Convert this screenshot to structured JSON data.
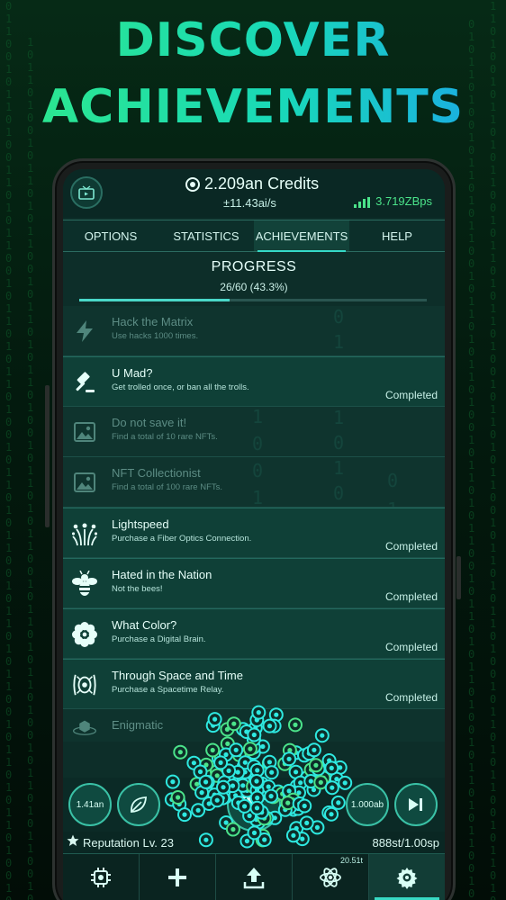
{
  "promo": {
    "line1": "DISCOVER",
    "line2": "ACHIEVEMENTS"
  },
  "header": {
    "credits": "2.209an Credits",
    "rate": "±11.43ai/s",
    "bandwidth": "3.719ZBps"
  },
  "tabs": [
    {
      "label": "OPTIONS"
    },
    {
      "label": "STATISTICS"
    },
    {
      "label": "ACHIEVEMENTS",
      "active": true
    },
    {
      "label": "HELP"
    }
  ],
  "progress": {
    "title": "PROGRESS",
    "count": "26/60 (43.3%)",
    "fraction": 0.433
  },
  "achievements": [
    {
      "name": "Hack the Matrix",
      "desc": "Use hacks 1000 times.",
      "status": "",
      "icon": "lightning-icon",
      "locked": true
    },
    {
      "name": "U Mad?",
      "desc": "Get trolled once, or ban all the trolls.",
      "status": "Completed",
      "icon": "gavel-icon",
      "locked": false
    },
    {
      "name": "Do not save it!",
      "desc": "Find a total of 10 rare NFTs.",
      "status": "",
      "icon": "image-icon",
      "locked": true
    },
    {
      "name": "NFT Collectionist",
      "desc": "Find a total of 100 rare NFTs.",
      "status": "",
      "icon": "image-icon",
      "locked": true
    },
    {
      "name": "Lightspeed",
      "desc": "Purchase a Fiber Optics Connection.",
      "status": "Completed",
      "icon": "fiber-icon",
      "locked": false
    },
    {
      "name": "Hated in the Nation",
      "desc": "Not the bees!",
      "status": "Completed",
      "icon": "bee-icon",
      "locked": false
    },
    {
      "name": "What Color?",
      "desc": "Purchase a Digital Brain.",
      "status": "Completed",
      "icon": "flower-icon",
      "locked": false
    },
    {
      "name": "Through Space and Time",
      "desc": "Purchase a Spacetime Relay.",
      "status": "Completed",
      "icon": "portal-icon",
      "locked": false
    },
    {
      "name": "Enigmatic",
      "desc": "",
      "status": "",
      "icon": "box-icon",
      "locked": true
    }
  ],
  "actions": {
    "left_value": "1.41an",
    "right_value": "1.000ab"
  },
  "reputation": {
    "label": "Reputation Lv. 23",
    "speed": "888st/1.00sp"
  },
  "nav": {
    "badge": "20.51t"
  },
  "colors": {
    "accent": "#38dac4",
    "promo_green": "#2ee88a",
    "promo_blue": "#1aa8e8",
    "bandwidth": "#4be38a"
  }
}
